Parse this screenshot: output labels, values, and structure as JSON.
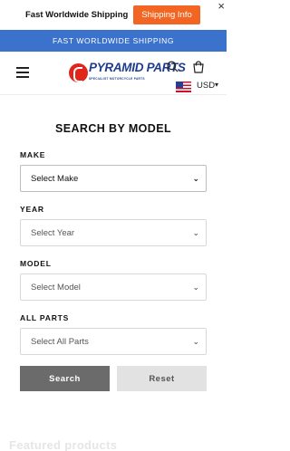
{
  "promo": {
    "text": "Fast Worldwide Shipping",
    "button_label": "Shipping Info",
    "close_glyph": "×"
  },
  "announcement": {
    "text": "FAST WORLDWIDE SHIPPING"
  },
  "header": {
    "logo_main": "PYRAMID PARTS",
    "logo_sub": "SPECIALIST MOTORCYCLE PARTS",
    "currency": "USD",
    "icons": [
      "menu-icon",
      "search-icon",
      "cart-icon",
      "us-flag-icon",
      "chevron-down-icon"
    ]
  },
  "search_by_model": {
    "title": "SEARCH BY MODEL",
    "fields": [
      {
        "label": "MAKE",
        "value": "Select Make"
      },
      {
        "label": "YEAR",
        "value": "Select Year"
      },
      {
        "label": "MODEL",
        "value": "Select Model"
      },
      {
        "label": "ALL PARTS",
        "value": "Select All Parts"
      }
    ],
    "search_label": "Search",
    "reset_label": "Reset"
  },
  "featured": {
    "title": "Featured products"
  },
  "colors": {
    "accent": "#f26522",
    "announcement_bg": "#3b73cc",
    "brand": "#1e3d8f",
    "search_btn": "#6b6b6b"
  }
}
